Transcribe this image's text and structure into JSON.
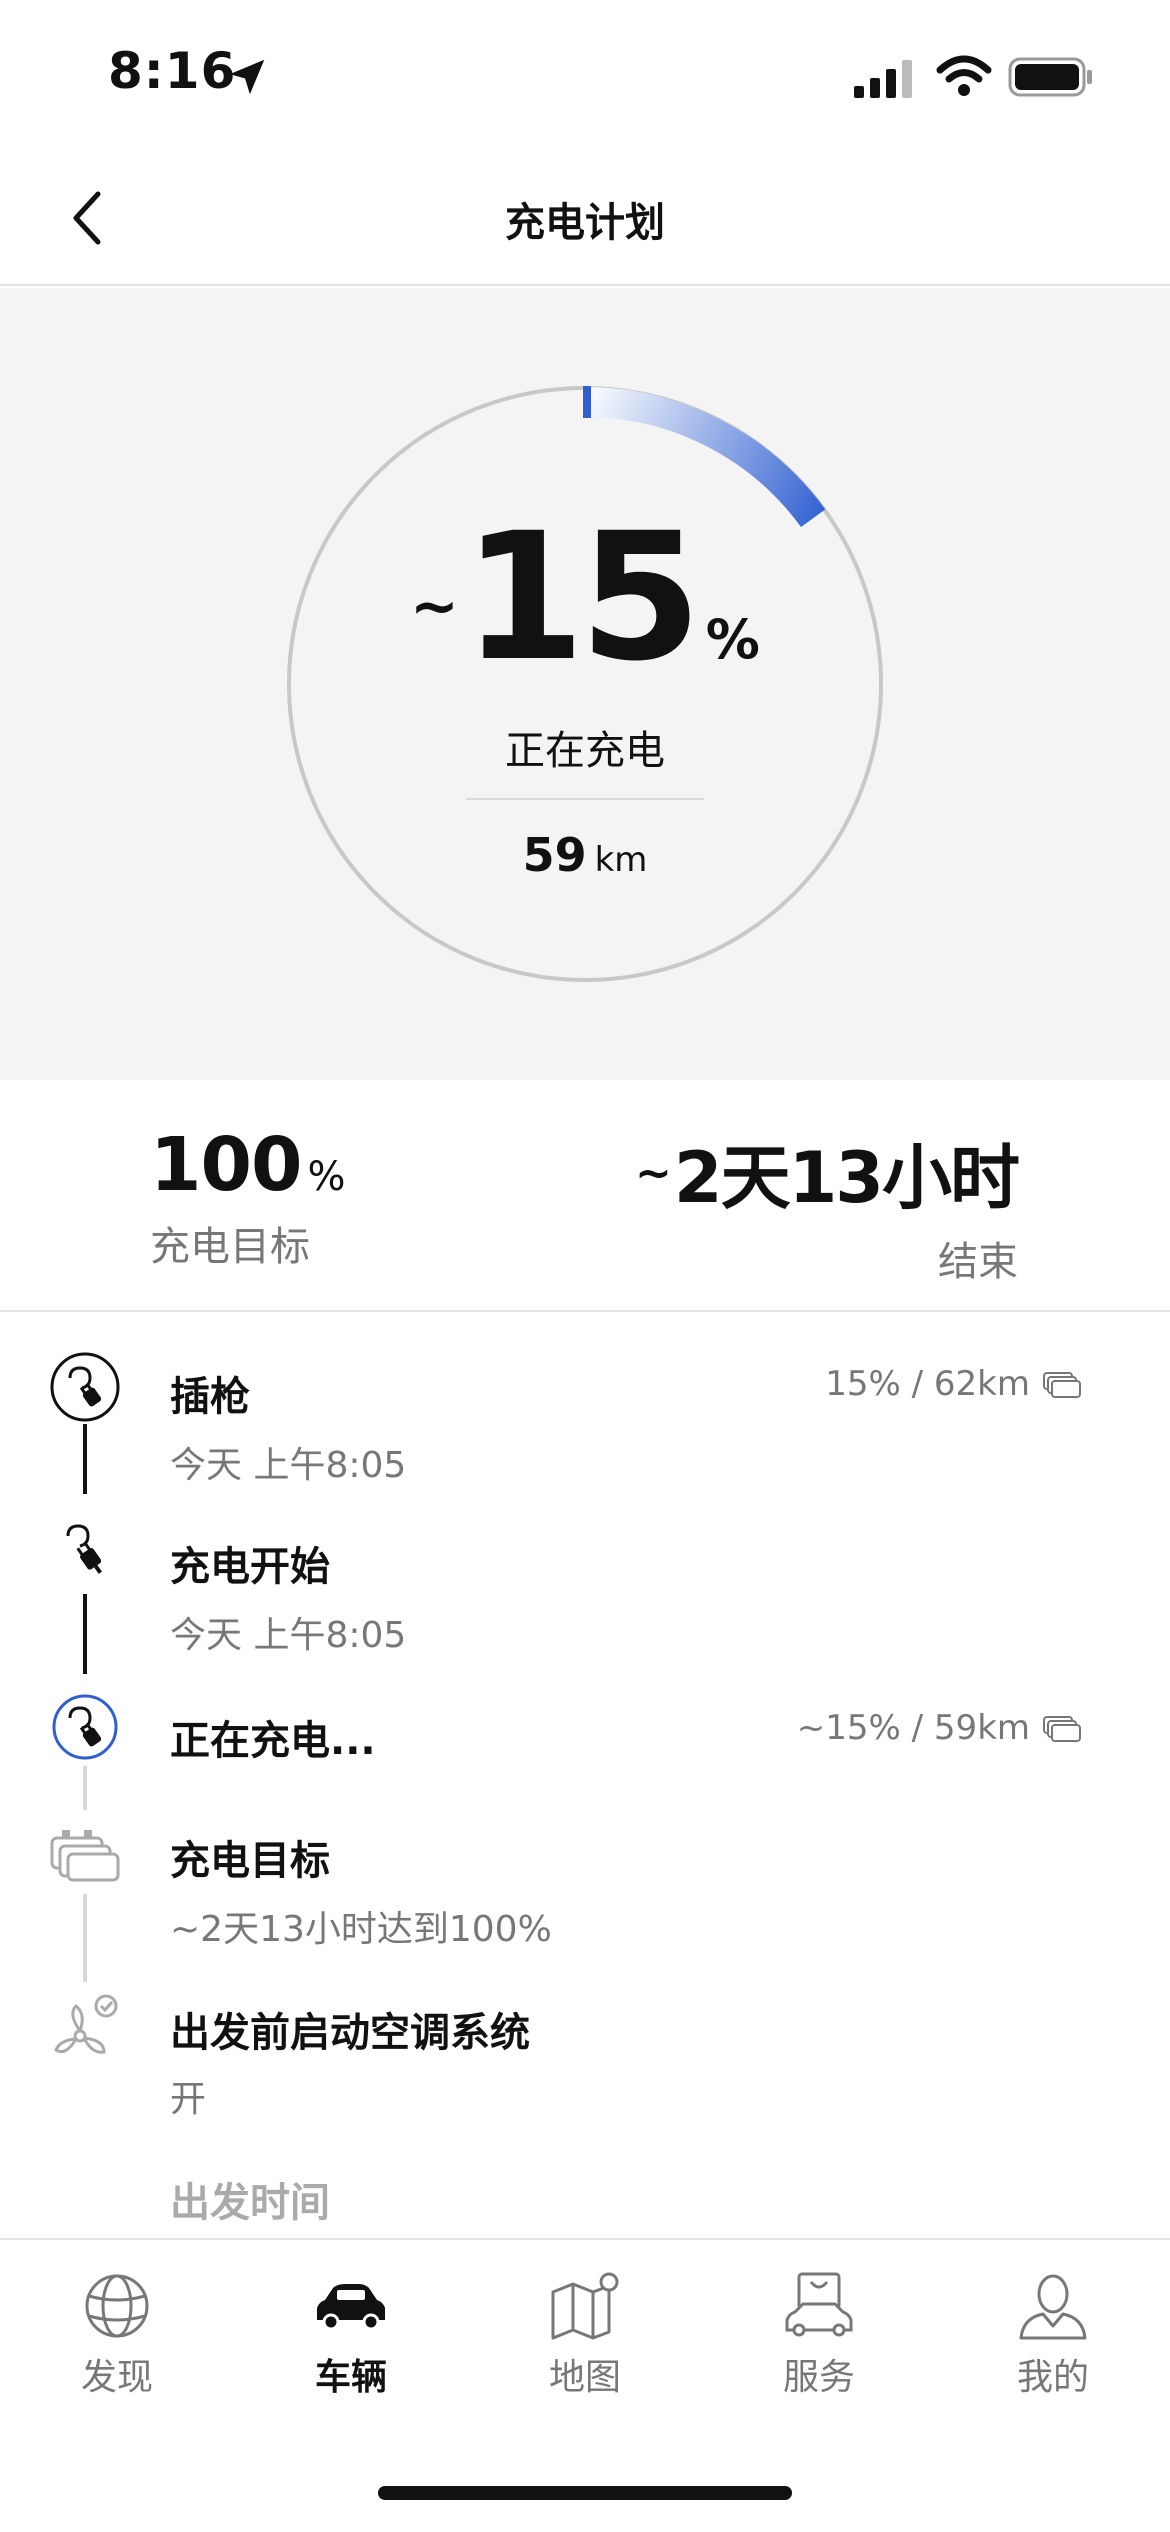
{
  "status_bar": {
    "time": "8:16"
  },
  "nav": {
    "title": "充电计划"
  },
  "hero": {
    "tilde": "~",
    "charge_percent": "15",
    "charge_progress": 0.15,
    "percent_unit": "%",
    "status": "正在充电",
    "range_value": "59",
    "range_unit": "km"
  },
  "summary": {
    "target_value": "100",
    "target_unit": "%",
    "target_label": "充电目标",
    "end_tilde": "~",
    "end_value": "2天13小时",
    "end_label": "结束"
  },
  "timeline": [
    {
      "title": "插枪",
      "subtitle": "今天 上午8:05",
      "right": "15% / 62km",
      "icon": "plug-circle-icon"
    },
    {
      "title": "充电开始",
      "subtitle": "今天 上午8:05",
      "icon": "plug-icon"
    },
    {
      "title": "正在充电...",
      "right": "~15% / 59km",
      "icon": "charging-circle-icon"
    },
    {
      "title": "充电目标",
      "subtitle": "~2天13小时达到100%",
      "icon": "battery-stack-icon"
    },
    {
      "title": "出发前启动空调系统",
      "subtitle": "开",
      "icon": "fan-icon"
    },
    {
      "title": "出发时间"
    }
  ],
  "tabs": [
    {
      "label": "发现",
      "icon": "globe-icon",
      "active": false
    },
    {
      "label": "车辆",
      "icon": "car-icon",
      "active": true
    },
    {
      "label": "地图",
      "icon": "map-icon",
      "active": false
    },
    {
      "label": "服务",
      "icon": "service-icon",
      "active": false
    },
    {
      "label": "我的",
      "icon": "profile-icon",
      "active": false
    }
  ],
  "colors": {
    "accent": "#2f5fd0",
    "ring": "#c8c8c8",
    "text_muted": "#777777"
  }
}
